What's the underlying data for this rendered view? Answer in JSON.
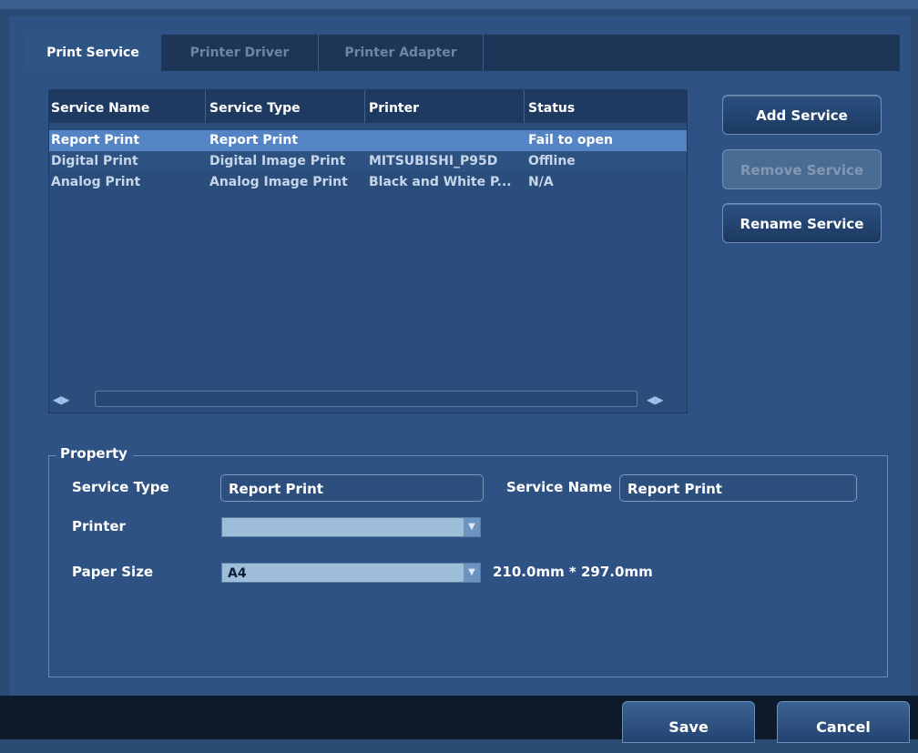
{
  "tabs": [
    {
      "label": "Print Service",
      "active": true
    },
    {
      "label": "Printer Driver",
      "active": false
    },
    {
      "label": "Printer Adapter",
      "active": false
    }
  ],
  "table": {
    "columns": [
      "Service Name",
      "Service Type",
      "Printer",
      "Status"
    ],
    "rows": [
      {
        "service_name": "Report Print",
        "service_type": "Report Print",
        "printer": "",
        "status": "Fail to open",
        "selected": true
      },
      {
        "service_name": "Digital Print",
        "service_type": "Digital Image Print",
        "printer": "MITSUBISHI_P95D",
        "status": "Offline",
        "selected": false
      },
      {
        "service_name": "Analog Print",
        "service_type": "Analog Image Print",
        "printer": "Black and White P...",
        "status": "N/A",
        "selected": false
      }
    ]
  },
  "actions": {
    "add_service": "Add Service",
    "remove_service": "Remove Service",
    "rename_service": "Rename Service"
  },
  "property": {
    "title": "Property",
    "service_type_label": "Service Type",
    "service_type_value": "Report Print",
    "service_name_label": "Service Name",
    "service_name_value": "Report Print",
    "printer_label": "Printer",
    "printer_value": "",
    "paper_size_label": "Paper Size",
    "paper_size_value": "A4",
    "paper_dimensions": "210.0mm * 297.0mm"
  },
  "footer": {
    "save": "Save",
    "cancel": "Cancel"
  },
  "colors": {
    "background": "#2e5284",
    "selected_row": "#5584c6",
    "header": "#1e3a61"
  }
}
